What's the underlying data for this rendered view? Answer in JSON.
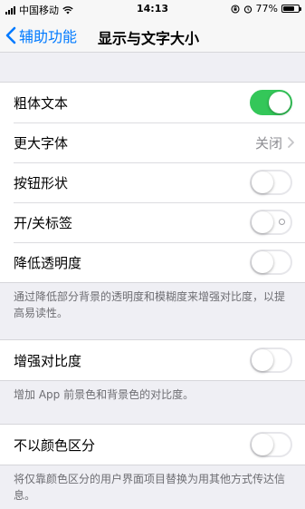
{
  "status_bar": {
    "carrier": "中国移动",
    "time": "14:13",
    "battery_percent": "77%",
    "battery_level": 0.77,
    "icons": [
      "signal-icon",
      "wifi-icon",
      "orientation-lock-icon",
      "alarm-icon",
      "battery-icon"
    ]
  },
  "nav": {
    "back_label": "辅助功能",
    "title": "显示与文字大小"
  },
  "colors": {
    "accent": "#007aff",
    "toggle_on": "#34c759",
    "background": "#efeff4"
  },
  "groups": [
    {
      "rows": [
        {
          "label": "粗体文本",
          "control": "toggle",
          "on": true
        },
        {
          "label": "更大字体",
          "control": "disclosure",
          "value": "关闭"
        },
        {
          "label": "按钮形状",
          "control": "toggle",
          "on": false
        },
        {
          "label": "开/关标签",
          "control": "toggle",
          "on": false
        },
        {
          "label": "降低透明度",
          "control": "toggle",
          "on": false
        }
      ],
      "footer": "通过降低部分背景的透明度和模糊度来增强对比度，以提高易读性。"
    },
    {
      "rows": [
        {
          "label": "增强对比度",
          "control": "toggle",
          "on": false
        }
      ],
      "footer": "增加 App 前景色和背景色的对比度。"
    },
    {
      "rows": [
        {
          "label": "不以颜色区分",
          "control": "toggle",
          "on": false
        }
      ],
      "footer": "将仅靠颜色区分的用户界面项目替换为用其他方式传达信息。"
    }
  ]
}
